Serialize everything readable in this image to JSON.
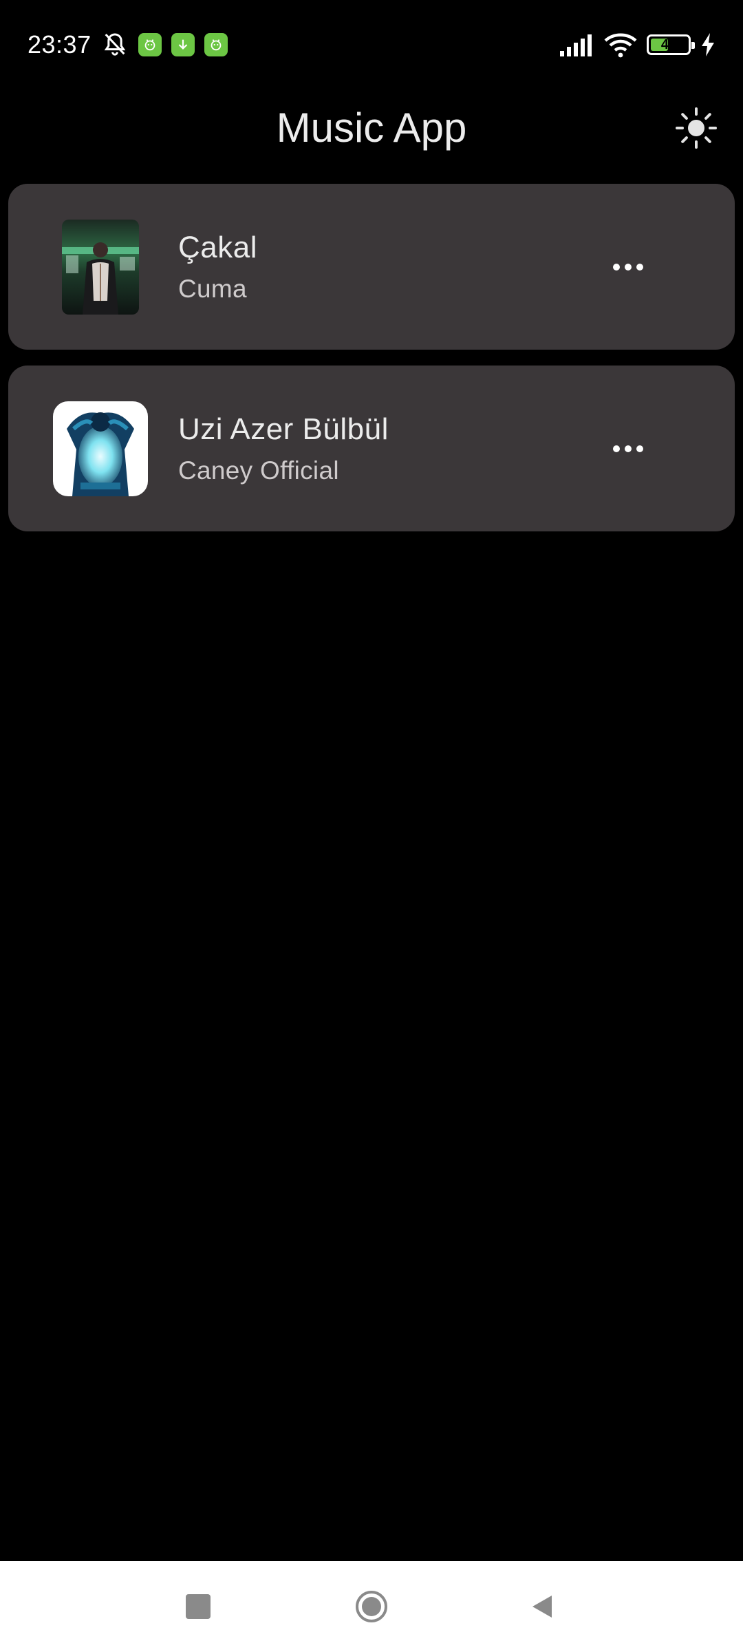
{
  "status_bar": {
    "time": "23:37",
    "icons": [
      "bell-off-icon",
      "app-badge-icon",
      "download-icon",
      "app-badge-icon",
      "signal-icon",
      "wifi-icon",
      "battery-icon",
      "charging-icon"
    ],
    "battery_level": "49",
    "battery_fraction": 0.49,
    "accent_color": "#6cc644"
  },
  "app_bar": {
    "title": "Music App",
    "theme_icon": "sun-icon"
  },
  "songs": [
    {
      "title": "Çakal",
      "artist": "Cuma",
      "menu_icon": "more-horizontal-icon"
    },
    {
      "title": "Uzi Azer Bülbül",
      "artist": "Caney Official",
      "menu_icon": "more-horizontal-icon"
    }
  ],
  "colors": {
    "background": "#000000",
    "card": "#3b3739",
    "title_text": "#ececec",
    "subtitle_text": "#cfcbcc",
    "nav_bar": "#ffffff"
  },
  "nav_bar": {
    "buttons": [
      "recents-icon",
      "home-icon",
      "back-icon"
    ]
  }
}
